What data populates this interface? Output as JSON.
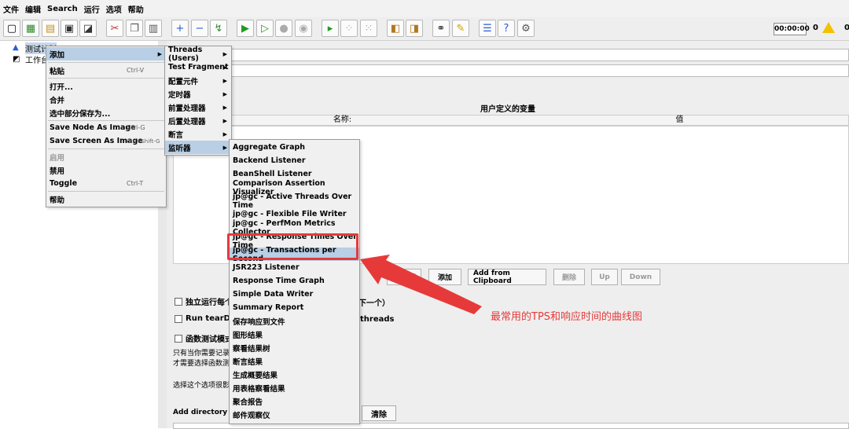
{
  "menubar": {
    "items": [
      "文件",
      "编辑",
      "Search",
      "运行",
      "选项",
      "帮助"
    ]
  },
  "toolbar": {
    "timer": "00:00:00",
    "error_count": "0",
    "warning_count": "0"
  },
  "tree": {
    "root_label": "测试计划",
    "workbench_label": "工作台"
  },
  "panel": {
    "vars_title": "用户定义的变量",
    "col_name": "名称:",
    "col_value": "值",
    "buttons": {
      "detail": "Detail",
      "add": "添加",
      "add_clipboard": "Add from Clipboard",
      "delete": "删除",
      "up": "Up",
      "down": "Down"
    },
    "check_independent": "独立运行每个",
    "check_independent_tail": "下一个）",
    "check_teardown": "Run tearDown",
    "check_teardown_tail": "threads",
    "check_functional": "函数测试模式",
    "note1": "只有当你需要记录",
    "note2": "才需要选择函数测",
    "note3": "选择这个选项很影响",
    "add_dir_label": "Add directory or j",
    "clear_button": "清除"
  },
  "context_menu": {
    "items": [
      {
        "label": "添加",
        "shortcut": "",
        "submenu": true,
        "selected": true
      },
      {
        "label": "粘贴",
        "shortcut": "Ctrl-V"
      },
      {
        "label": "打开...",
        "shortcut": ""
      },
      {
        "label": "合并",
        "shortcut": ""
      },
      {
        "label": "选中部分保存为...",
        "shortcut": ""
      },
      {
        "label": "Save Node As Image",
        "shortcut": "Ctrl-G"
      },
      {
        "label": "Save Screen As Image",
        "shortcut": "Ctrl+Shift-G"
      },
      {
        "label": "启用",
        "shortcut": "",
        "disabled": true
      },
      {
        "label": "禁用",
        "shortcut": ""
      },
      {
        "label": "Toggle",
        "shortcut": "Ctrl-T"
      },
      {
        "label": "帮助",
        "shortcut": ""
      }
    ]
  },
  "add_submenu": {
    "items": [
      {
        "label": "Threads (Users)"
      },
      {
        "label": "Test Fragment"
      },
      {
        "label": "配置元件"
      },
      {
        "label": "定时器"
      },
      {
        "label": "前置处理器"
      },
      {
        "label": "后置处理器"
      },
      {
        "label": "断言"
      },
      {
        "label": "监听器",
        "selected": true
      }
    ]
  },
  "listener_submenu": {
    "items": [
      "Aggregate Graph",
      "Backend Listener",
      "BeanShell Listener",
      "Comparison Assertion Visualizer",
      "jp@gc - Active Threads Over Time",
      "jp@gc - Flexible File Writer",
      "jp@gc - PerfMon Metrics Collector",
      "jp@gc - Response Times Over Time",
      "jp@gc - Transactions per Second",
      "JSR223 Listener",
      "Response Time Graph",
      "Simple Data Writer",
      "Summary Report",
      "保存响应到文件",
      "图形结果",
      "察看结果树",
      "断言结果",
      "生成概要结果",
      "用表格察看结果",
      "聚合报告",
      "邮件观察仪"
    ],
    "selected_index": 8
  },
  "annotation": {
    "text": "最常用的TPS和响应时间的曲线图",
    "color": "#e63a3a"
  }
}
